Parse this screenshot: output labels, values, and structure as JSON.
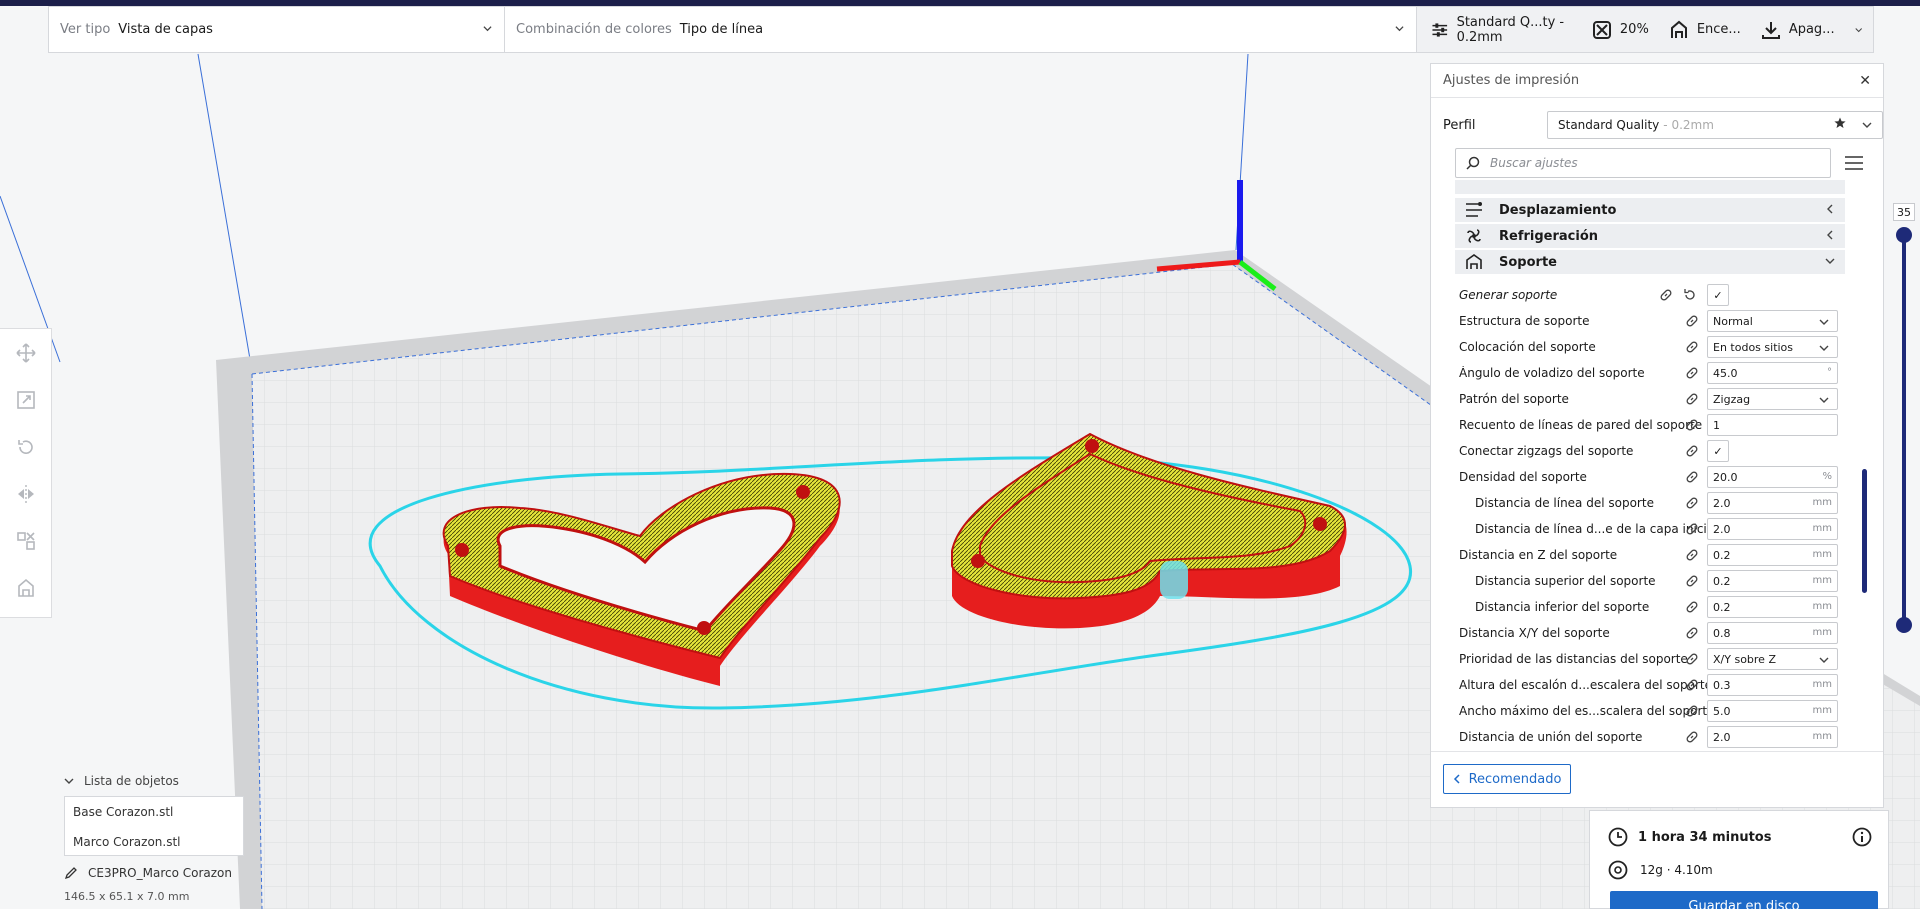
{
  "header": {
    "view_type_label": "Ver tipo",
    "view_type_value": "Vista de capas",
    "color_scheme_label": "Combinación de colores",
    "color_scheme_value": "Tipo de línea",
    "profile_summary": "Standard Q...ty - 0.2mm",
    "infill_summary": "20%",
    "adhesion_summary": "Ence...",
    "support_summary": "Apag..."
  },
  "panel": {
    "title": "Ajustes de impresión",
    "close": "✕",
    "profile_label": "Perfil",
    "profile_value": "Standard Quality",
    "profile_sub": "- 0.2mm",
    "search_placeholder": "Buscar ajustes",
    "categories": [
      {
        "label": "Desplazamiento",
        "icon": "travel-icon",
        "expanded": false
      },
      {
        "label": "Refrigeración",
        "icon": "fan-icon",
        "expanded": false
      },
      {
        "label": "Soporte",
        "icon": "support-icon",
        "expanded": true
      }
    ],
    "settings": [
      {
        "label": "Generar soporte",
        "type": "check",
        "value": "✓"
      },
      {
        "label": "Estructura de soporte",
        "type": "select",
        "value": "Normal"
      },
      {
        "label": "Colocación del soporte",
        "type": "select",
        "value": "En todos sitios"
      },
      {
        "label": "Ángulo de voladizo del soporte",
        "type": "input",
        "value": "45.0",
        "unit": "°"
      },
      {
        "label": "Patrón del soporte",
        "type": "select",
        "value": "Zigzag"
      },
      {
        "label": "Recuento de líneas de pared del soporte",
        "type": "input",
        "value": "1",
        "unit": ""
      },
      {
        "label": "Conectar zigzags del soporte",
        "type": "check",
        "value": "✓"
      },
      {
        "label": "Densidad del soporte",
        "type": "input",
        "value": "20.0",
        "unit": "%"
      },
      {
        "label": "Distancia de línea del soporte",
        "type": "input",
        "value": "2.0",
        "unit": "mm"
      },
      {
        "label": "Distancia de línea d...e de la capa inicial",
        "type": "input",
        "value": "2.0",
        "unit": "mm"
      },
      {
        "label": "Distancia en Z del soporte",
        "type": "input",
        "value": "0.2",
        "unit": "mm"
      },
      {
        "label": "Distancia superior del soporte",
        "type": "input",
        "value": "0.2",
        "unit": "mm"
      },
      {
        "label": "Distancia inferior del soporte",
        "type": "input",
        "value": "0.2",
        "unit": "mm"
      },
      {
        "label": "Distancia X/Y del soporte",
        "type": "input",
        "value": "0.8",
        "unit": "mm"
      },
      {
        "label": "Prioridad de las distancias del soporte",
        "type": "select",
        "value": "X/Y sobre Z"
      },
      {
        "label": "Altura del escalón d...escalera del soporte",
        "type": "input",
        "value": "0.3",
        "unit": "mm"
      },
      {
        "label": "Ancho máximo del es...scalera del soporte",
        "type": "input",
        "value": "5.0",
        "unit": "mm"
      },
      {
        "label": "Distancia de unión del soporte",
        "type": "input",
        "value": "2.0",
        "unit": "mm"
      }
    ],
    "recommended_button": "Recomendado"
  },
  "layer_slider": {
    "value": "35"
  },
  "objects": {
    "header": "Lista de objetos",
    "items": [
      "Base Corazon.stl",
      "Marco Corazon.stl"
    ],
    "job_name": "CE3PRO_Marco Corazon",
    "dimensions": "146.5 x 65.1 x 7.0 mm"
  },
  "estimate": {
    "time": "1 hora 34 minutos",
    "material": "12g · 4.10m",
    "save_button": "Guardar en disco"
  }
}
